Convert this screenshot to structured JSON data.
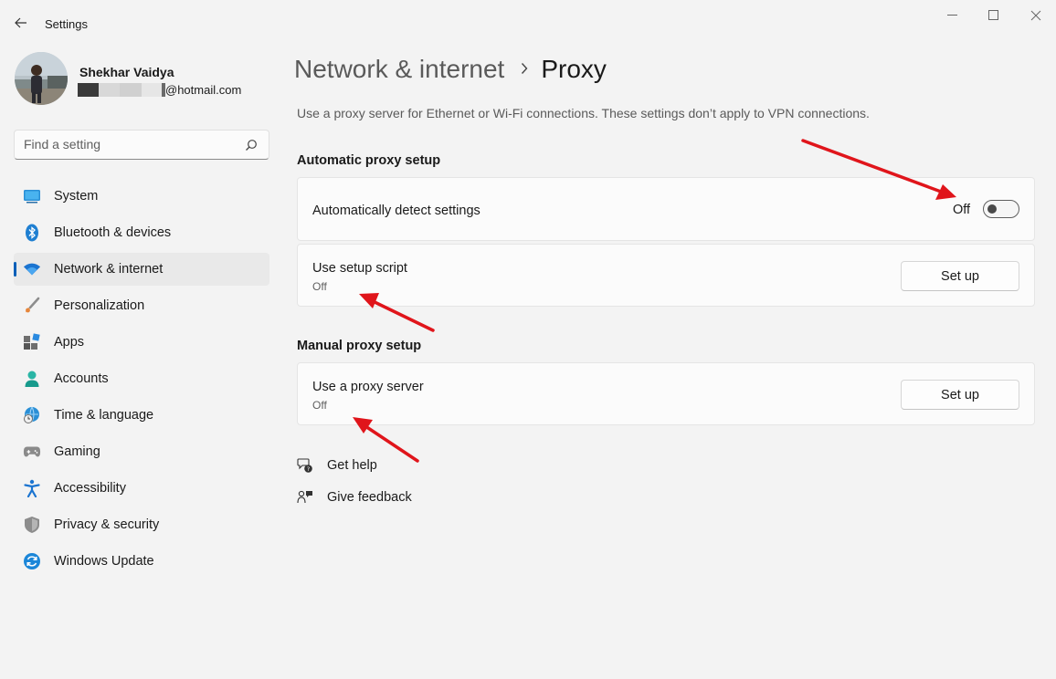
{
  "window": {
    "title": "Settings",
    "back_icon": "back-arrow-icon",
    "controls": [
      "minimize-icon",
      "maximize-icon",
      "close-icon"
    ]
  },
  "profile": {
    "name": "Shekhar Vaidya",
    "email_suffix": "@hotmail.com"
  },
  "search": {
    "placeholder": "Find a setting"
  },
  "sidebar": {
    "items": [
      {
        "label": "System",
        "icon": "system-icon",
        "active": false
      },
      {
        "label": "Bluetooth & devices",
        "icon": "bluetooth-icon",
        "active": false
      },
      {
        "label": "Network & internet",
        "icon": "wifi-icon",
        "active": true
      },
      {
        "label": "Personalization",
        "icon": "brush-icon",
        "active": false
      },
      {
        "label": "Apps",
        "icon": "apps-icon",
        "active": false
      },
      {
        "label": "Accounts",
        "icon": "accounts-icon",
        "active": false
      },
      {
        "label": "Time & language",
        "icon": "globe-clock-icon",
        "active": false
      },
      {
        "label": "Gaming",
        "icon": "gamepad-icon",
        "active": false
      },
      {
        "label": "Accessibility",
        "icon": "accessibility-icon",
        "active": false
      },
      {
        "label": "Privacy & security",
        "icon": "shield-icon",
        "active": false
      },
      {
        "label": "Windows Update",
        "icon": "update-icon",
        "active": false
      }
    ]
  },
  "main": {
    "breadcrumb_parent": "Network & internet",
    "breadcrumb_current": "Proxy",
    "description": "Use a proxy server for Ethernet or Wi-Fi connections. These settings don’t apply to VPN connections.",
    "automatic": {
      "title": "Automatic proxy setup",
      "detect": {
        "label": "Automatically detect settings",
        "state": "Off"
      },
      "script": {
        "label": "Use setup script",
        "sub": "Off",
        "button": "Set up"
      }
    },
    "manual": {
      "title": "Manual proxy setup",
      "proxy": {
        "label": "Use a proxy server",
        "sub": "Off",
        "button": "Set up"
      }
    },
    "links": {
      "help": "Get help",
      "feedback": "Give feedback"
    }
  },
  "colors": {
    "accent": "#005fb8",
    "annotation": "#e0151b"
  }
}
